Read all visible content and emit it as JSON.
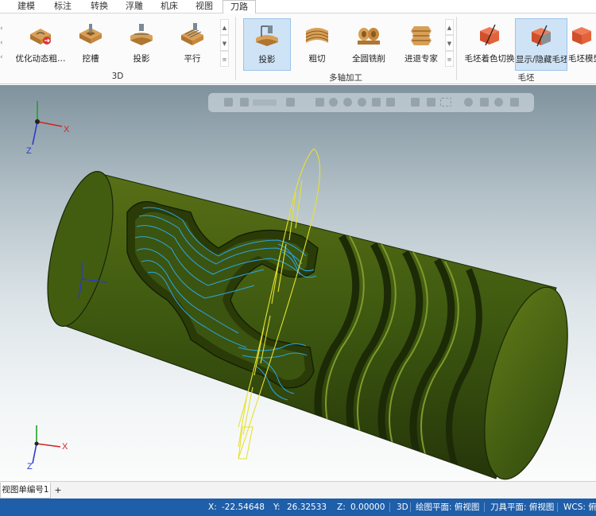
{
  "menu": {
    "tabs": [
      {
        "label": "建模"
      },
      {
        "label": "标注"
      },
      {
        "label": "转换"
      },
      {
        "label": "浮雕"
      },
      {
        "label": "机床"
      },
      {
        "label": "视图"
      },
      {
        "label": "刀路",
        "active": true
      }
    ]
  },
  "ribbon": {
    "groups": [
      {
        "label": "3D",
        "buttons": [
          "优化动态粗…",
          "挖槽",
          "投影",
          "平行"
        ]
      },
      {
        "label": "多轴加工",
        "buttons": [
          "投影",
          "粗切",
          "全圆铣削",
          "进退专家"
        ]
      },
      {
        "label": "毛坯",
        "buttons": [
          "毛坯着色切换",
          "显示/隐藏毛坯",
          "毛坯模型"
        ]
      }
    ],
    "selected_button": "投影 (多轴加工)"
  },
  "viewport": {
    "triad_axes": {
      "x": "X",
      "y": "Y",
      "z": "Z"
    },
    "model_color": "#3f5a12",
    "toolpath_color": "#2aa6e8",
    "wireframe_color": "#e7e22e"
  },
  "view_tabs": {
    "tabs": [
      {
        "label": "视图单编号1"
      }
    ],
    "add_label": "+"
  },
  "status": {
    "x_label": "X:",
    "x_value": "-22.54648",
    "y_label": "Y:",
    "y_value": "26.32533",
    "z_label": "Z:",
    "z_value": "0.00000",
    "mode": "3D",
    "draw_plane": "绘图平面: 俯视图",
    "tool_plane": "刀具平面: 俯视图",
    "wcs": "WCS: 俯视图"
  },
  "colors": {
    "accent": "#1f5ea8",
    "selected": "#cfe3f7"
  }
}
